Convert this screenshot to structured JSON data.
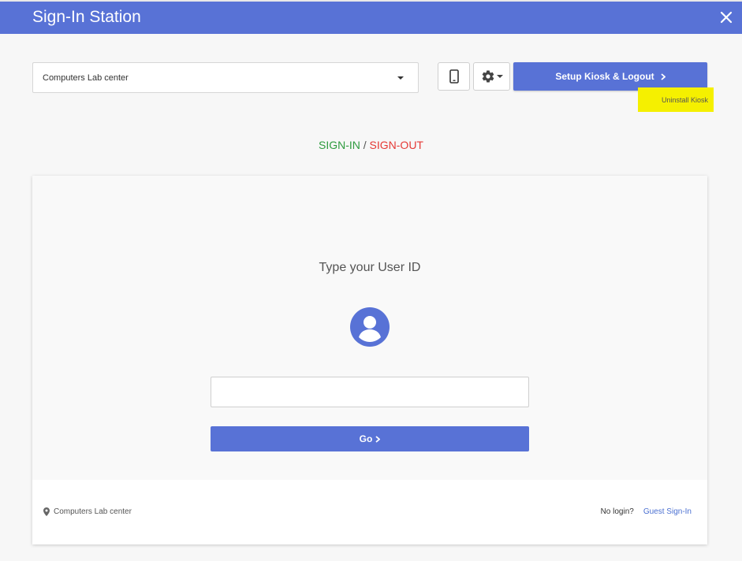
{
  "window": {
    "title": "Sign-In Station"
  },
  "toolbar": {
    "location_selected": "Computers Lab center",
    "setup_label": "Setup Kiosk & Logout",
    "uninstall_label": "Uninstall Kiosk"
  },
  "mode": {
    "sign_in": "SIGN-IN",
    "separator": " / ",
    "sign_out": "SIGN-OUT"
  },
  "card": {
    "prompt": "Type your User ID",
    "input_value": "",
    "go_label": "Go"
  },
  "footer": {
    "location": "Computers Lab center",
    "no_login": "No login?",
    "guest_link": "Guest Sign-In"
  },
  "colors": {
    "accent": "#5872d6",
    "sign_in": "#2e9b3e",
    "sign_out": "#e53935",
    "highlight": "#f5f000"
  },
  "icons": {
    "close": "close-icon",
    "mobile": "mobile-phone-icon",
    "settings": "gear-icon",
    "chevron": "chevron-right-icon",
    "avatar": "user-avatar-icon",
    "location": "map-pin-icon"
  }
}
